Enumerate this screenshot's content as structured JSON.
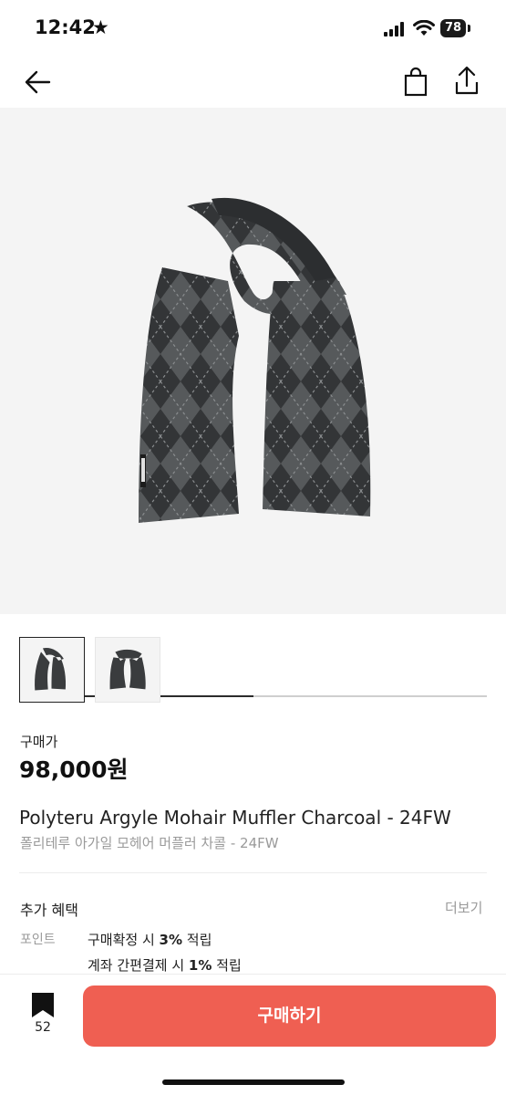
{
  "status_bar": {
    "time": "12:42",
    "battery": "78"
  },
  "nav": {
    "back_icon": "arrow-left-icon",
    "bag_icon": "shopping-bag-icon",
    "share_icon": "share-icon"
  },
  "gallery": {
    "progress": 0.5,
    "thumbnail_count": 2
  },
  "product": {
    "price_label": "구매가",
    "price": "98,000원",
    "title_en": "Polyteru Argyle Mohair Muffler Charcoal - 24FW",
    "title_ko": "폴리테루 아가일 모헤어 머플러 차콜 - 24FW"
  },
  "benefits": {
    "title": "추가 혜택",
    "more": "더보기",
    "point_label": "포인트",
    "line1_prefix": "구매확정 시 ",
    "line1_value": "3%",
    "line1_suffix": " 적립",
    "line2_prefix": "계좌 간편결제 시 ",
    "line2_value": "1%",
    "line2_suffix": " 적립"
  },
  "bottom": {
    "bookmark_count": "52",
    "buy_label": "구매하기"
  },
  "colors": {
    "accent": "#ef5f52",
    "muted_text": "#9a9a9a",
    "image_bg": "#f4f4f4"
  }
}
